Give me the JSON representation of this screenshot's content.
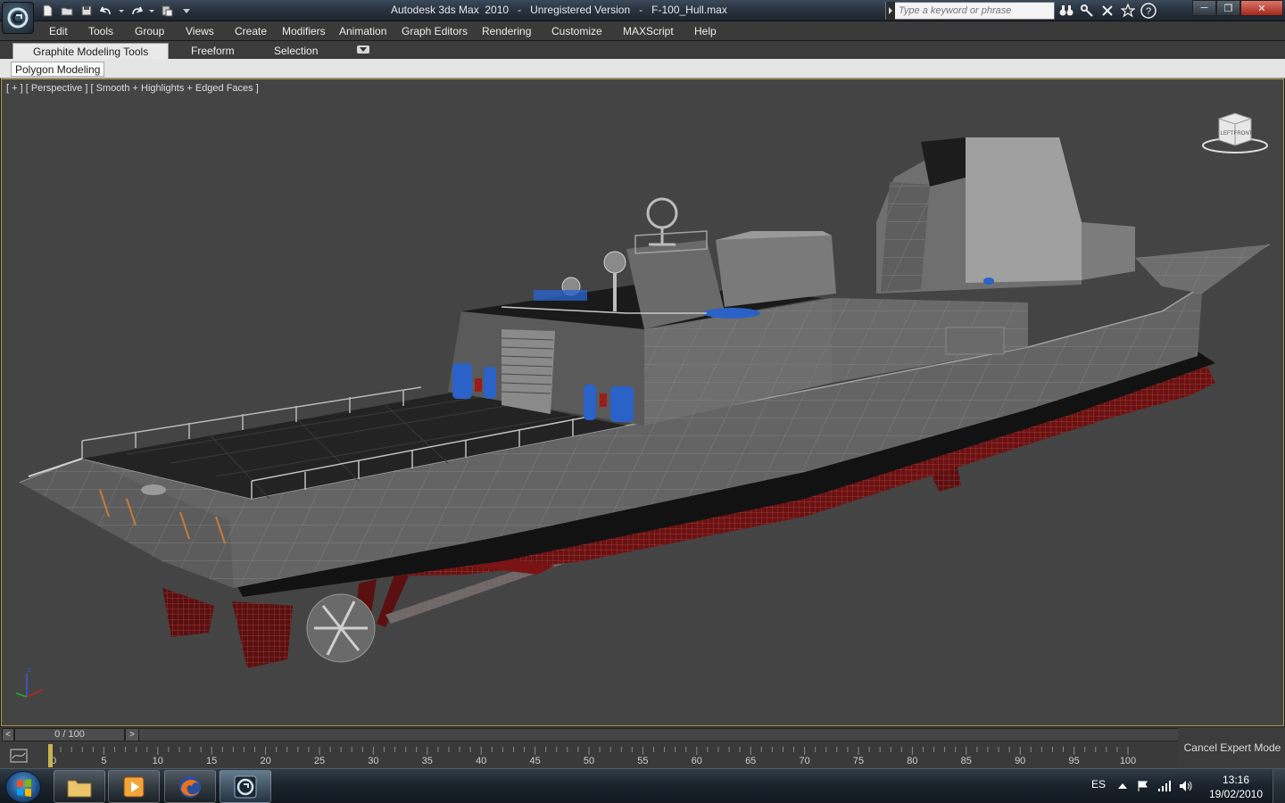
{
  "window": {
    "app_title": "Autodesk 3ds Max  2010",
    "version_note": "Unregistered Version",
    "file_name": "F-100_Hull.max"
  },
  "search": {
    "placeholder": "Type a keyword or phrase"
  },
  "menu": {
    "items": [
      "Edit",
      "Tools",
      "Group",
      "Views",
      "Create",
      "Modifiers",
      "Animation",
      "Graph Editors",
      "Rendering",
      "Customize",
      "MAXScript",
      "Help"
    ]
  },
  "ribbon": {
    "tabs": [
      "Graphite Modeling Tools",
      "Freeform",
      "Selection"
    ],
    "active_tab": "Graphite Modeling Tools",
    "panel_button": "Polygon Modeling"
  },
  "viewport": {
    "label": "[ + ] [ Perspective ] [ Smooth + Highlights + Edged Faces ]",
    "viewcube_left": "LEFT",
    "viewcube_front": "FRONT",
    "border_color": "#b19a45",
    "background_color": "#444444"
  },
  "time_slider": {
    "position_text": "0 / 100",
    "left_arrow": "<",
    "right_arrow": ">"
  },
  "trackbar": {
    "ticks": [
      "0",
      "5",
      "10",
      "15",
      "20",
      "25",
      "30",
      "35",
      "40",
      "45",
      "50",
      "55",
      "60",
      "65",
      "70",
      "75",
      "80",
      "85",
      "90",
      "95",
      "100"
    ]
  },
  "expert_mode": {
    "label": "Cancel Expert Mode"
  },
  "taskbar": {
    "apps": [
      "explorer-icon",
      "media-player-icon",
      "firefox-icon",
      "3dsmax-icon"
    ],
    "language": "ES",
    "time": "13:16",
    "date": "19/02/2010"
  },
  "colors": {
    "hull_gray": "#6d6d6d",
    "waterline_red": "#7a1414",
    "selection_blue": "#2a62c8",
    "menu_bg": "#3a3a3a",
    "titlebar_bg": "#2a3440"
  }
}
